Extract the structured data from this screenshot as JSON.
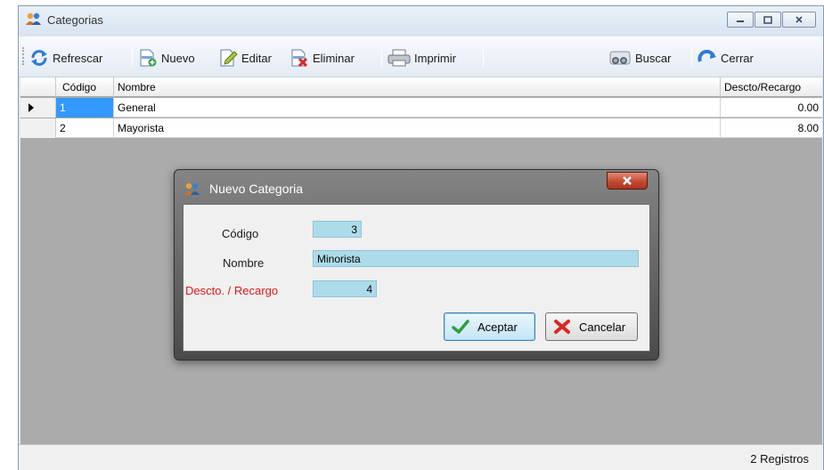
{
  "window": {
    "title": "Categorias"
  },
  "toolbar": {
    "refresh": "Refrescar",
    "new": "Nuevo",
    "edit": "Editar",
    "delete": "Eliminar",
    "print": "Imprimir",
    "search": "Buscar",
    "close": "Cerrar"
  },
  "grid": {
    "columns": {
      "code": "Código",
      "name": "Nombre",
      "discount": "Descto/Recargo"
    },
    "rows": [
      {
        "code": "1",
        "name": "General",
        "discount": "0.00"
      },
      {
        "code": "2",
        "name": "Mayorista",
        "discount": "8.00"
      }
    ]
  },
  "status": {
    "records": "2 Registros"
  },
  "dialog": {
    "title": "Nuevo Categoria",
    "code_label": "Código",
    "code_value": "3",
    "name_label": "Nombre",
    "name_value": "Minorista",
    "discount_label": "Descto. / Recargo",
    "discount_value": "4",
    "accept": "Aceptar",
    "cancel": "Cancelar"
  },
  "colors": {
    "selection": "#3399ff",
    "input_bg": "#aedbe9",
    "required_label": "#e0171b",
    "grid_empty": "#ababab"
  }
}
